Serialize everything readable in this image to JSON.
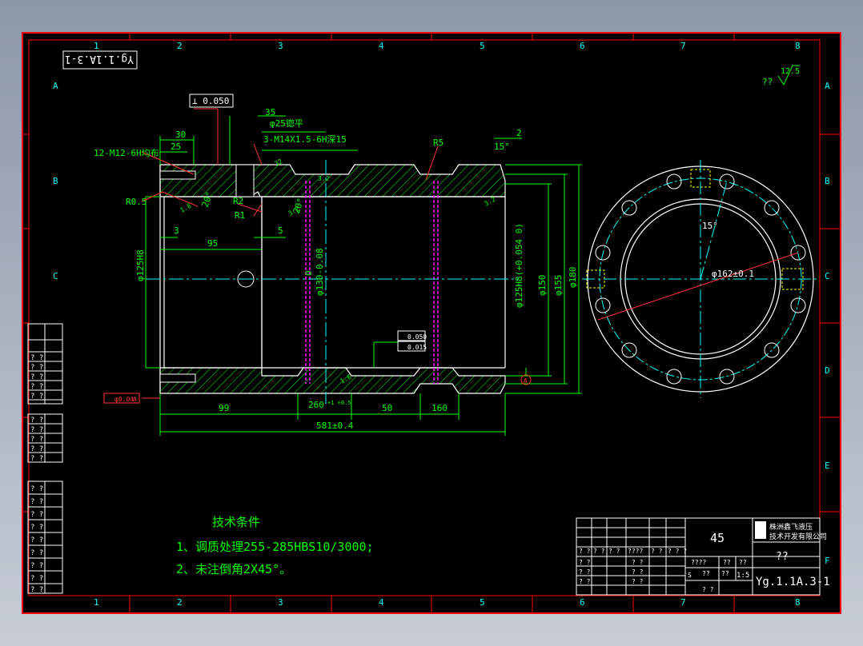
{
  "drawing_number": "Yg.1.1A.3-1",
  "drawing_number_rotated": "Yg.1.1A.3-1",
  "columns": [
    "1",
    "2",
    "3",
    "4",
    "5",
    "6",
    "7",
    "8"
  ],
  "rows": [
    "A",
    "B",
    "C",
    "D",
    "E",
    "F"
  ],
  "surface_finish": {
    "symbol": "??",
    "value": "12.5"
  },
  "dimensions": {
    "perp_tol": "⊥ 0.050",
    "d35": "35",
    "d_spot": "φ25锪平",
    "d30": "30",
    "d25": "25",
    "thread_side": "3-M14X1.5-6H深15",
    "thread_end": "12-M12-6H均布",
    "r5": "R5",
    "d15deg": "15°",
    "d2": "2",
    "r05": "R0.5",
    "d20deg_a": "20°",
    "d20deg_b": "20°",
    "r2": "R2",
    "r1": "R1",
    "d3": "3",
    "d95": "95",
    "d5": "5",
    "bore_left": "φ125H8",
    "od_groove": "φ130-0.08",
    "od_groove_top": "0",
    "bore_right": "φ125H8(+0.054 0)",
    "d150": "φ150",
    "d155": "φ155",
    "d180": "φ180",
    "tol_parallel": "0.050",
    "tol_cyl": "0.015",
    "coax": "φ0.04",
    "coax_ref": "A",
    "datum": "A",
    "d99": "99",
    "d260": "260",
    "d260_tol": "+1 +0.5",
    "d50": "50",
    "d160": "160",
    "d581": "581±0.4",
    "rough1": "32",
    "rough2": "3.2",
    "rough3": "1.6",
    "rough4": "3.2",
    "rough5": "3.2",
    "rough6": "1.6"
  },
  "end_view": {
    "pcd": "φ162±0.1",
    "angle": "15°"
  },
  "notes": {
    "title": "技术条件",
    "line1": "1、调质处理255-285HBS10/3000;",
    "line2": "2、未注倒角2X45°。"
  },
  "title_block": {
    "material": "45",
    "company_line1": "株洲鑫飞液压",
    "company_line2": "技术开发有限公司",
    "part_name": "??",
    "scale": "1:5",
    "drawing_no": "Yg.1.1A.3-1",
    "marks": [
      "??",
      "??",
      "? ?",
      "? ?",
      "????",
      "? ?",
      "? ?",
      "? ? ?",
      "? ?",
      "? ?",
      "? ?",
      "????",
      "??",
      "??",
      "S",
      "? ?",
      "? ?",
      "? ?",
      "? ?"
    ]
  },
  "side_table_marks": [
    "? ?",
    "? ?",
    "? ?",
    "? ?",
    "? ?",
    "? ?",
    "? ?",
    "? ?",
    "? ?",
    "? ?",
    "? ?",
    "? ?",
    "? ?",
    "? ?",
    "? ?",
    "? ?",
    "? ?",
    "? ?",
    "? ?",
    "? ?"
  ],
  "colors": {
    "border": "#ff0000",
    "dimension": "#00ff00",
    "outline": "#ffffff",
    "center": "#00ffff",
    "hatch": "#00ff00",
    "pin": "#ff00ff",
    "highlight": "#ffff00"
  }
}
